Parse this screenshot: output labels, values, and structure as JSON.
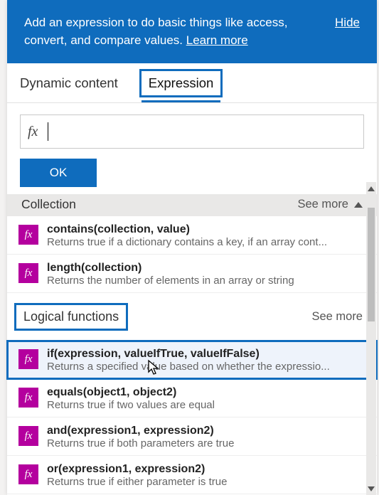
{
  "banner": {
    "text_prefix": "Add an expression to do basic things like access, convert, and compare values. ",
    "learn_more": "Learn more",
    "hide": "Hide"
  },
  "tabs": {
    "dynamic": "Dynamic content",
    "expression": "Expression"
  },
  "expr": {
    "value": "",
    "ok": "OK"
  },
  "sections": {
    "collection": {
      "title": "Collection",
      "see_more": "See more"
    },
    "logical": {
      "title": "Logical functions",
      "see_more": "See more"
    }
  },
  "functions": {
    "contains": {
      "sig": "contains(collection, value)",
      "desc": "Returns true if a dictionary contains a key, if an array cont..."
    },
    "length": {
      "sig": "length(collection)",
      "desc": "Returns the number of elements in an array or string"
    },
    "if": {
      "sig": "if(expression, valueIfTrue, valueIfFalse)",
      "desc": "Returns a specified value based on whether the expressio..."
    },
    "equals": {
      "sig": "equals(object1, object2)",
      "desc": "Returns true if two values are equal"
    },
    "and": {
      "sig": "and(expression1, expression2)",
      "desc": "Returns true if both parameters are true"
    },
    "or": {
      "sig": "or(expression1, expression2)",
      "desc": "Returns true if either parameter is true"
    }
  },
  "glyphs": {
    "fx": "fx"
  }
}
